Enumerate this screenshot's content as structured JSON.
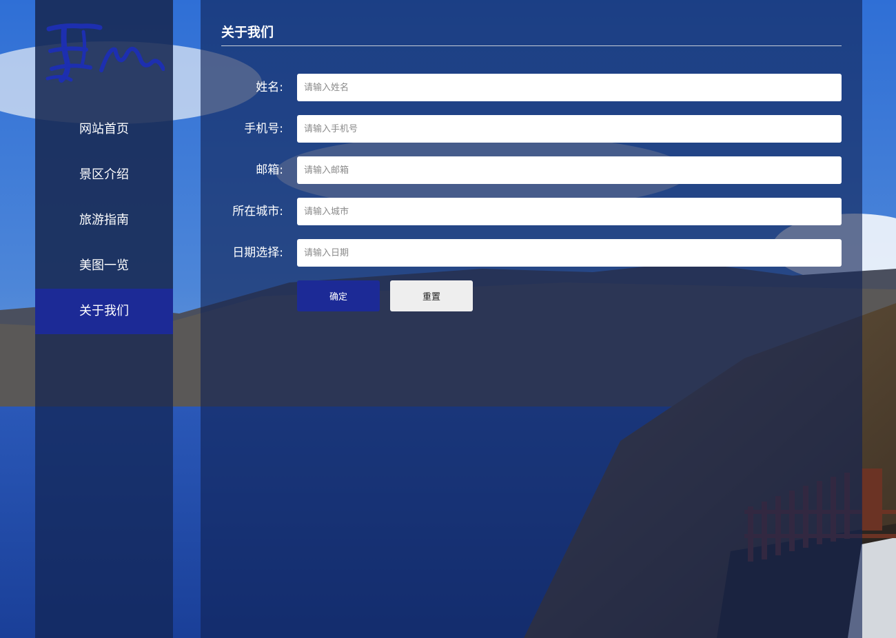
{
  "brand": {
    "logo_icon": "calligraphy-logo-icon",
    "logo_color": "#1d2fb0"
  },
  "colors": {
    "accent": "#1c2a96",
    "panel": "#10224f",
    "reset_bg": "#eeeeee"
  },
  "nav": {
    "items": [
      {
        "label": "网站首页",
        "active": false
      },
      {
        "label": "景区介绍",
        "active": false
      },
      {
        "label": "旅游指南",
        "active": false
      },
      {
        "label": "美图一览",
        "active": false
      },
      {
        "label": "关于我们",
        "active": true
      }
    ]
  },
  "page": {
    "title": "关于我们"
  },
  "form": {
    "name": {
      "label": "姓名:",
      "placeholder": "请输入姓名",
      "value": ""
    },
    "phone": {
      "label": "手机号:",
      "placeholder": "请输入手机号",
      "value": ""
    },
    "email": {
      "label": "邮箱:",
      "placeholder": "请输入邮箱",
      "value": ""
    },
    "city": {
      "label": "所在城市:",
      "placeholder": "请输入城市",
      "value": ""
    },
    "date": {
      "label": "日期选择:",
      "placeholder": "请输入日期",
      "value": ""
    },
    "confirm_label": "确定",
    "reset_label": "重置"
  }
}
